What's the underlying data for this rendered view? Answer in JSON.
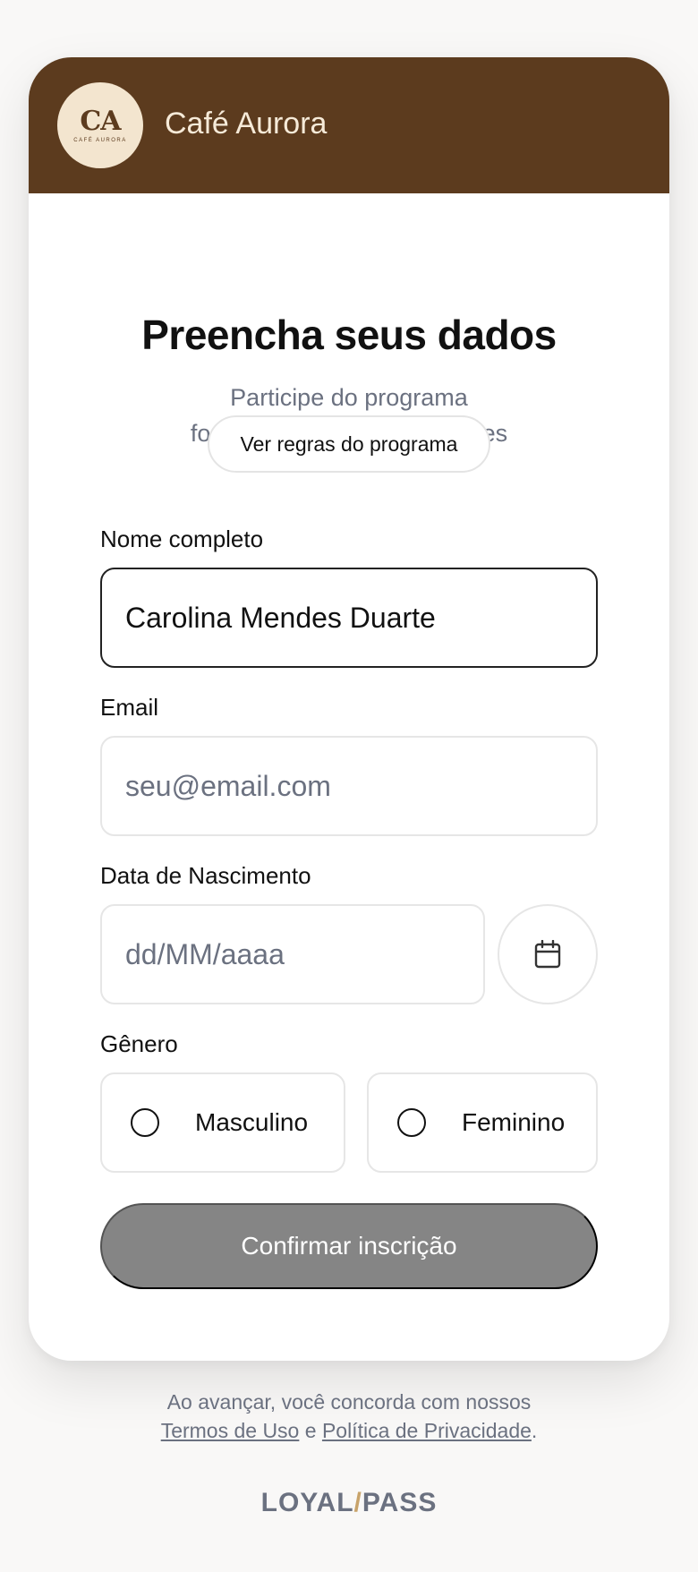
{
  "brand": {
    "logo_mark": "CA",
    "logo_sub": "CAFÉ AURORA",
    "name": "Café Aurora"
  },
  "header": {
    "title": "Preencha seus dados",
    "subtitle_line1": "Participe do programa",
    "subtitle_line2": "fornecendo suas informações",
    "rules_button": "Ver regras do programa"
  },
  "form": {
    "name": {
      "label": "Nome completo",
      "value": "Carolina Mendes Duarte"
    },
    "email": {
      "label": "Email",
      "placeholder": "seu@email.com",
      "value": ""
    },
    "birth": {
      "label": "Data de Nascimento",
      "placeholder": "dd/MM/aaaa",
      "value": ""
    },
    "gender": {
      "label": "Gênero",
      "options": [
        "Masculino",
        "Feminino"
      ],
      "selected": null
    },
    "submit": "Confirmar inscrição"
  },
  "legal": {
    "prefix": "Ao avançar, você concorda com nossos",
    "terms": "Termos de Uso",
    "joiner": "e",
    "privacy": "Política de Privacidade",
    "suffix": "."
  },
  "footer": {
    "logo_left": "LOYAL",
    "logo_slash": "/",
    "logo_right": "PASS"
  },
  "colors": {
    "brand": "#5c3b1e",
    "logo_bg": "#f3e5cf",
    "button_disabled": "#858585",
    "accent": "#c8a36a"
  },
  "icons": {
    "date_picker": "calendar-icon"
  }
}
